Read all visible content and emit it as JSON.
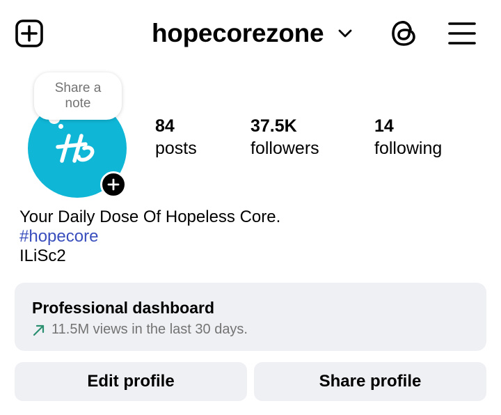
{
  "header": {
    "username": "hopecorezone",
    "icons": {
      "new_post": "plus-square-icon",
      "switch_account": "chevron-down-icon",
      "threads": "threads-icon",
      "menu": "hamburger-menu-icon"
    }
  },
  "profile": {
    "avatar_color": "#10b6d6",
    "note": "Share a note",
    "stats": {
      "posts": {
        "value": "84",
        "label": "posts"
      },
      "followers": {
        "value": "37.5K",
        "label": "followers"
      },
      "following": {
        "value": "14",
        "label": "following"
      }
    },
    "bio": {
      "line1": "Your Daily Dose Of Hopeless Core.",
      "hashtag": "#hopecore",
      "line3": "ILiSc2"
    }
  },
  "dashboard": {
    "title": "Professional dashboard",
    "subtitle": "11.5M views in the last 30 days.",
    "icon": "trend-up-icon"
  },
  "actions": {
    "edit_profile": "Edit profile",
    "share_profile": "Share profile"
  },
  "colors": {
    "accent_link": "#3a4fbd",
    "button_bg": "#eff0f4",
    "trend_icon": "#2a8f6f"
  }
}
